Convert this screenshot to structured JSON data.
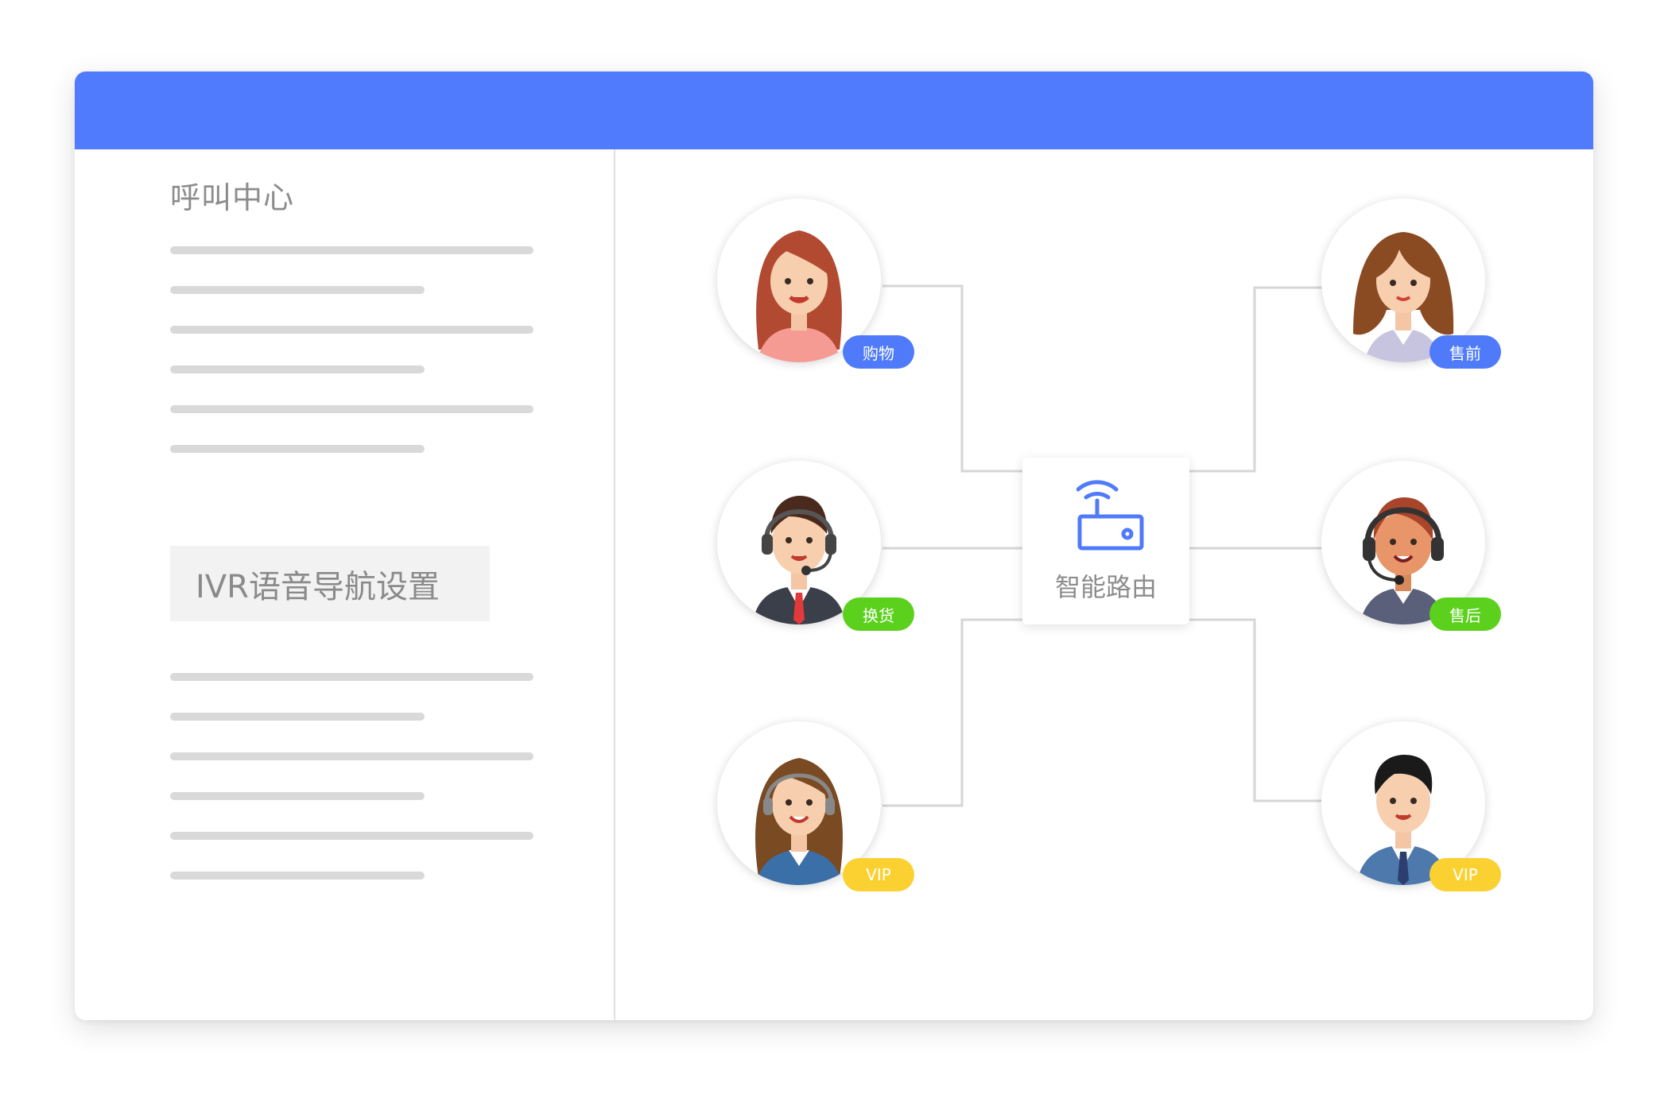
{
  "sidebar": {
    "title": "呼叫中心",
    "ivr_button": "IVR语音导航设置"
  },
  "router": {
    "label": "智能路由",
    "icon": "router-icon"
  },
  "agents": [
    {
      "tag": "购物",
      "tag_color": "#4f7bfa",
      "icon": "female-agent-avatar"
    },
    {
      "tag": "换货",
      "tag_color": "#5bd11d",
      "icon": "male-agent-headset-avatar"
    },
    {
      "tag": "VIP",
      "tag_color": "#fbd131",
      "icon": "female-agent-headset-avatar"
    },
    {
      "tag": "售前",
      "tag_color": "#4f7bfa",
      "icon": "female-agent-avatar"
    },
    {
      "tag": "售后",
      "tag_color": "#5bd11d",
      "icon": "female-agent-headset-avatar"
    },
    {
      "tag": "VIP",
      "tag_color": "#fbd131",
      "icon": "male-agent-suit-avatar"
    }
  ],
  "colors": {
    "titlebar": "#517bfd",
    "badge_blue": "#4f7bfa",
    "badge_green": "#5bd11d",
    "badge_yellow": "#fbd131"
  }
}
